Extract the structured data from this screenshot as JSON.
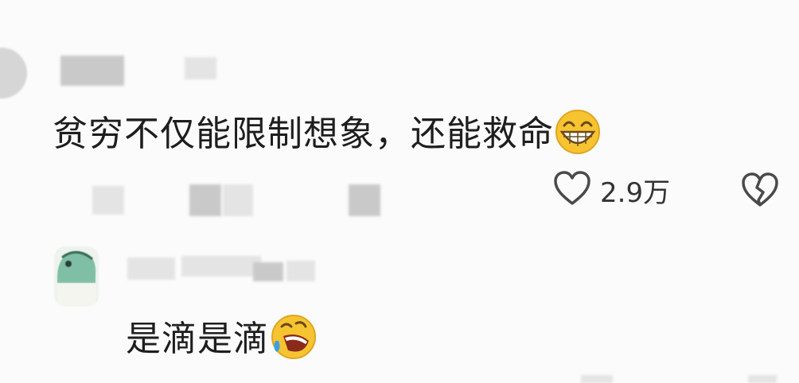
{
  "comments": [
    {
      "text": "贫穷不仅能限制想象，还能救命",
      "emoji": "grinning-face-icon",
      "like_count": "2.9万"
    },
    {
      "text": "是滴是滴",
      "emoji": "rolling-laughing-face-icon"
    }
  ],
  "colors": {
    "background": "#fbfbfb",
    "text": "#1e1e1e",
    "icon_stroke": "#4a4a4a",
    "emoji_yellow": "#f7c431"
  }
}
